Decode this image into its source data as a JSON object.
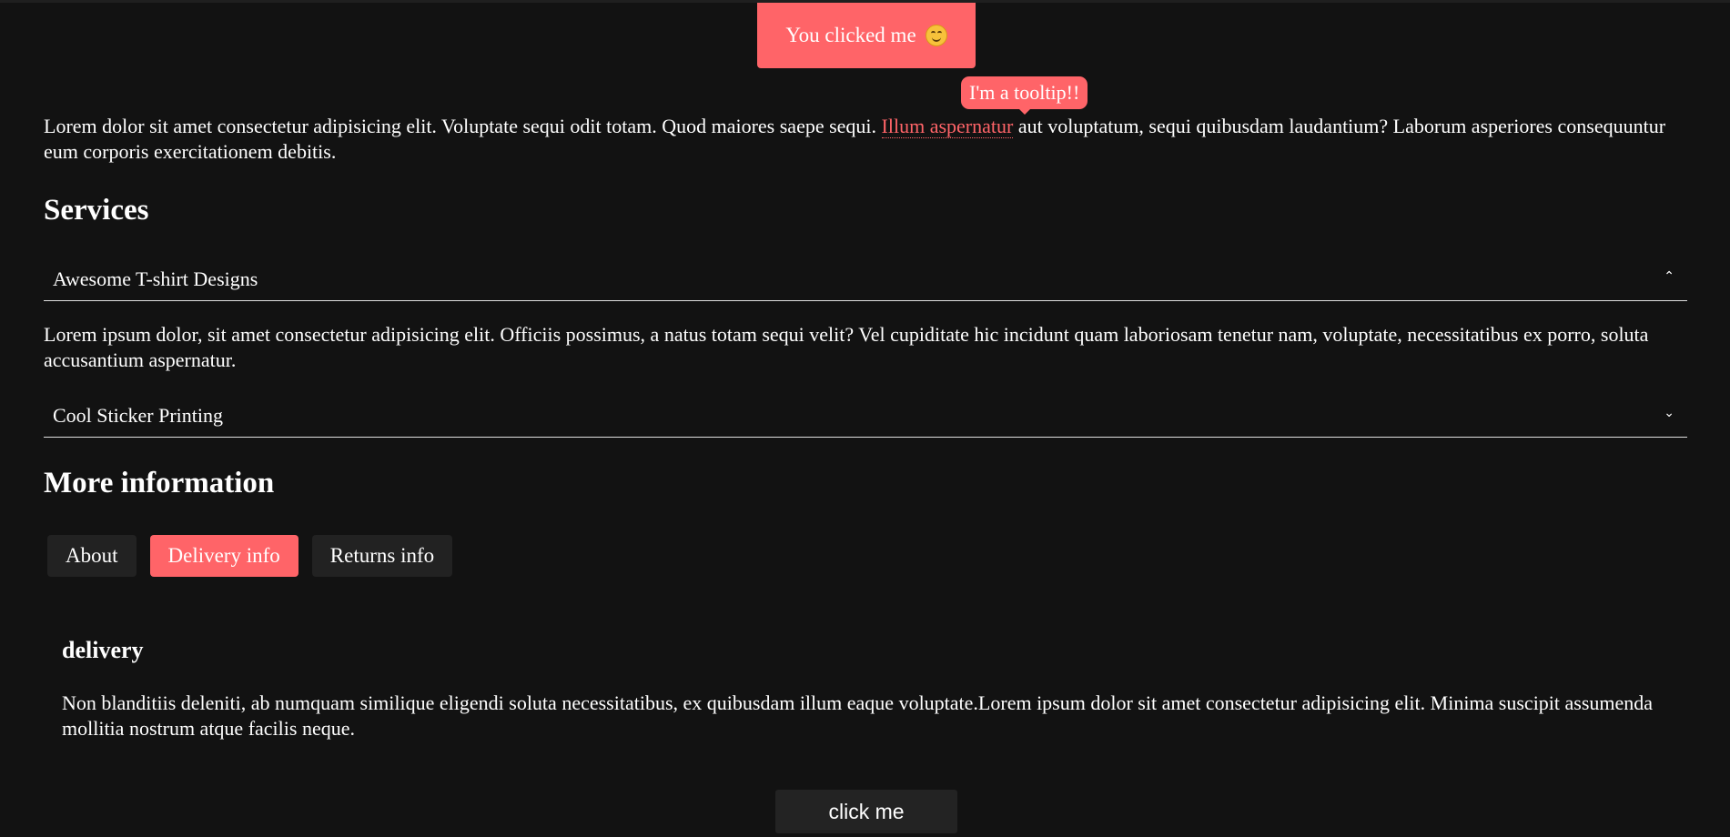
{
  "toast": {
    "text": "You clicked me",
    "icon": "smiling-face-icon",
    "color": "#ff6468"
  },
  "tooltip": {
    "text": "I'm a tooltip!!"
  },
  "intro": {
    "before": "Lorem dolor sit amet consectetur adipisicing elit. Voluptate sequi odit totam. Quod maiores saepe sequi. ",
    "link": "Illum aspernatur",
    "after": " aut voluptatum, sequi quibusdam laudantium? Laborum asperiores consequuntur eum corporis exercitationem debitis."
  },
  "services": {
    "title": "Services",
    "items": [
      {
        "label": "Awesome T-shirt Designs",
        "expanded": true,
        "chevron": "chevron-up-icon",
        "body": "Lorem ipsum dolor, sit amet consectetur adipisicing elit. Officiis possimus, a natus totam sequi velit? Vel cupiditate hic incidunt quam laboriosam tenetur nam, voluptate, necessitatibus ex porro, soluta accusantium aspernatur."
      },
      {
        "label": "Cool Sticker Printing",
        "expanded": false,
        "chevron": "chevron-down-icon"
      }
    ]
  },
  "more_info": {
    "title": "More information",
    "tabs": [
      {
        "label": "About",
        "active": false
      },
      {
        "label": "Delivery info",
        "active": true
      },
      {
        "label": "Returns info",
        "active": false
      }
    ],
    "panel": {
      "title": "delivery",
      "body": "Non blanditiis deleniti, ab numquam similique eligendi soluta necessitatibus, ex quibusdam illum eaque voluptate.Lorem ipsum dolor sit amet consectetur adipisicing elit. Minima suscipit assumenda mollitia nostrum atque facilis neque."
    }
  },
  "click_button": {
    "label": "click me"
  },
  "colors": {
    "background": "#121212",
    "accent": "#ff6468",
    "tab_bg": "#222222"
  }
}
